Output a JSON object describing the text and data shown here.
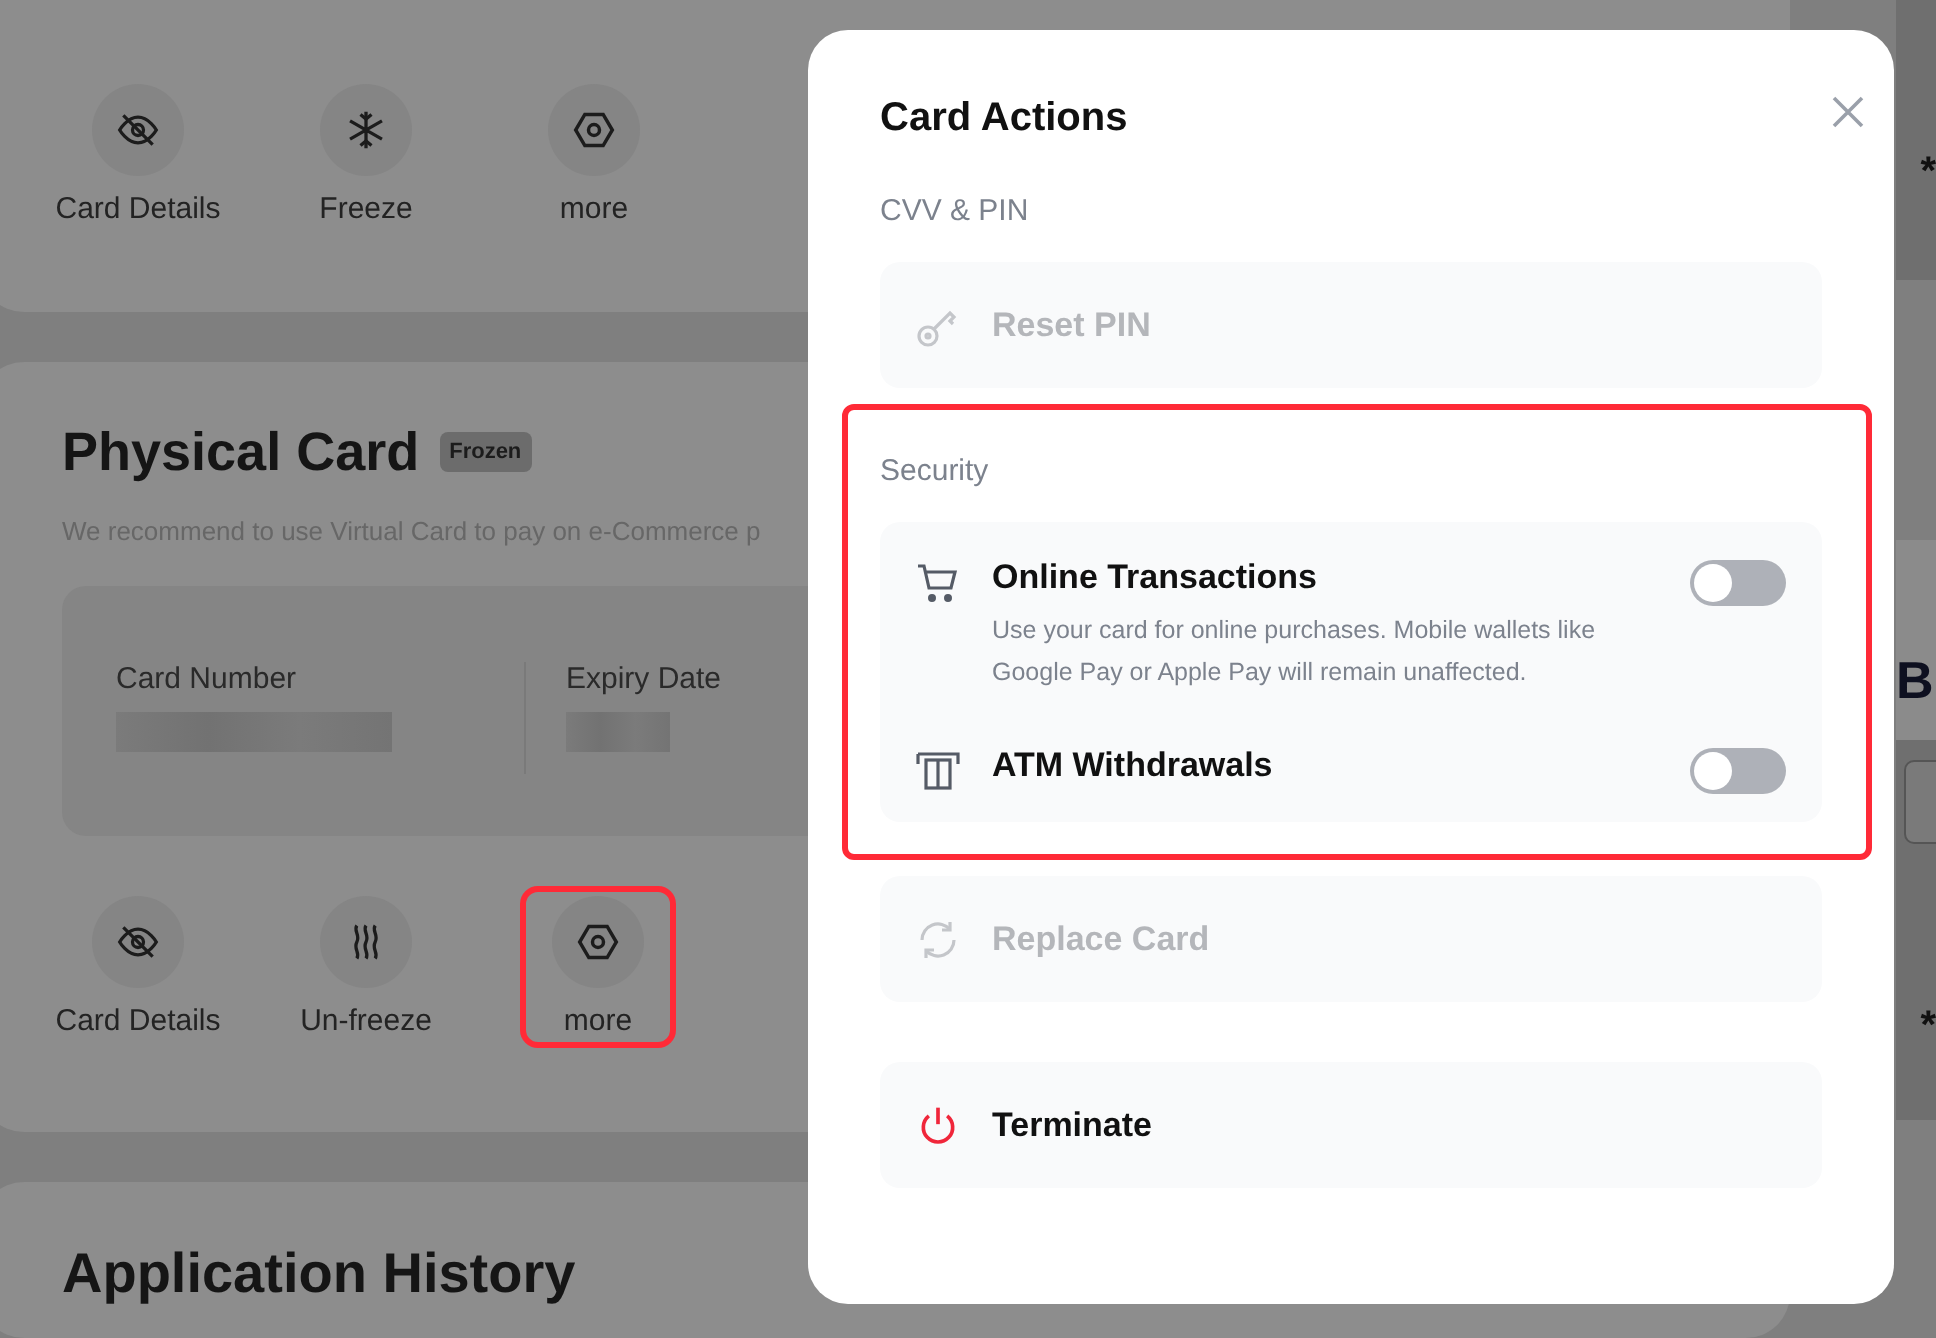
{
  "background": {
    "top_card": {
      "actions": [
        {
          "kind": "details",
          "label": "Card Details",
          "highlighted": false
        },
        {
          "kind": "freeze",
          "label": "Freeze",
          "highlighted": false
        },
        {
          "kind": "more",
          "label": "more",
          "highlighted": false
        }
      ]
    },
    "physical_card": {
      "title": "Physical Card",
      "badge": "Frozen",
      "subtitle": "We recommend to use Virtual Card to pay on e-Commerce p",
      "fields": [
        {
          "label": "Card Number"
        },
        {
          "label": "Expiry Date"
        }
      ],
      "actions": [
        {
          "kind": "details",
          "label": "Card Details",
          "highlighted": false
        },
        {
          "kind": "unfreeze",
          "label": "Un-freeze",
          "highlighted": false
        },
        {
          "kind": "more",
          "label": "more",
          "highlighted": true
        }
      ]
    },
    "history_title": "Application History",
    "card_preview": {
      "top_mark": "*",
      "brand": "B",
      "bottom_mark": "*"
    }
  },
  "modal": {
    "title": "Card Actions",
    "sections": [
      {
        "heading": "CVV & PIN",
        "highlighted": false,
        "items": [
          {
            "kind": "pin",
            "label": "Reset PIN",
            "disabled": true
          }
        ]
      },
      {
        "heading": "Security",
        "highlighted": true,
        "items": [
          {
            "kind": "online",
            "label": "Online Transactions",
            "description": "Use your card for online purchases. Mobile wallets like Google Pay or Apple Pay will remain unaffected.",
            "on": false
          },
          {
            "kind": "atm",
            "label": "ATM Withdrawals",
            "on": false
          }
        ]
      },
      {
        "highlighted": false,
        "items": [
          {
            "kind": "replace",
            "label": "Replace Card",
            "disabled": true
          }
        ]
      },
      {
        "highlighted": false,
        "items": [
          {
            "kind": "terminate",
            "label": "Terminate",
            "disabled": false
          }
        ]
      }
    ]
  }
}
